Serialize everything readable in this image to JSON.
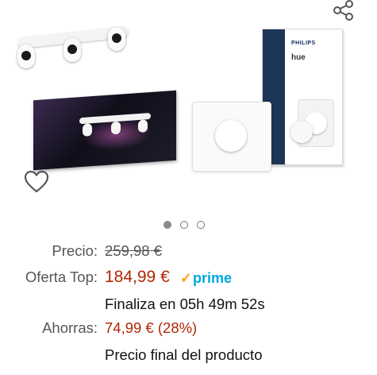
{
  "gallery": {
    "box_brand": "PHILIPS",
    "box_product": "hue",
    "dots": [
      {
        "active": true
      },
      {
        "active": false
      },
      {
        "active": false
      }
    ]
  },
  "price": {
    "list_label": "Precio:",
    "list_value": "259,98 €",
    "deal_label": "Oferta Top:",
    "deal_value": "184,99 €",
    "prime_label": "prime",
    "timer": "Finaliza en 05h 49m 52s",
    "savings_label": "Ahorras:",
    "savings_value": "74,99 € (28%)",
    "final_note": "Precio final del producto"
  },
  "colors": {
    "deal": "#b12704",
    "prime": "#00a8e1",
    "prime_check": "#f7a11a"
  }
}
